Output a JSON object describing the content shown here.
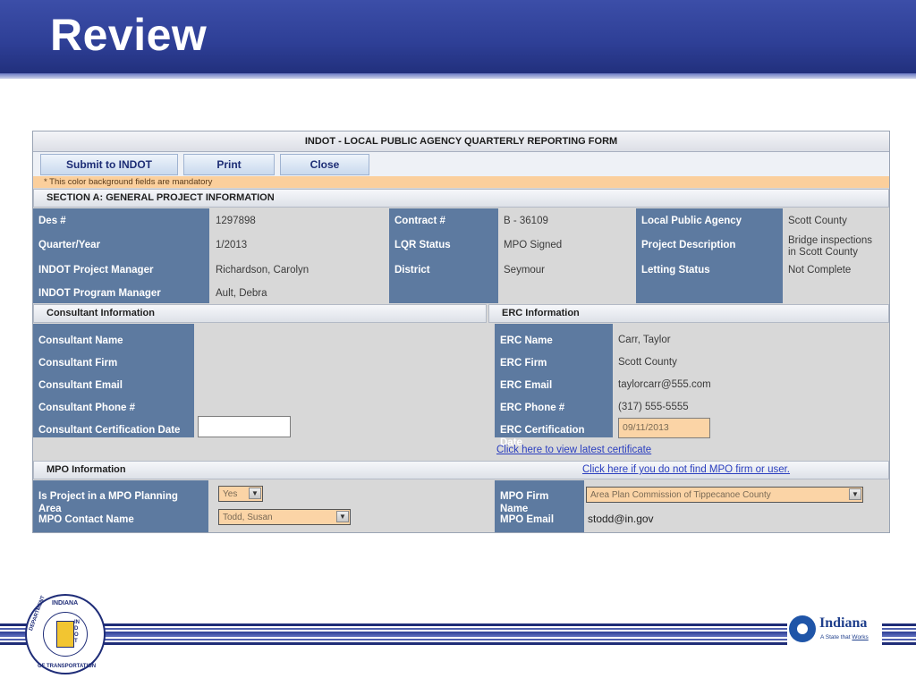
{
  "slide": {
    "title": "Review"
  },
  "form": {
    "title": "INDOT - LOCAL PUBLIC AGENCY QUARTERLY REPORTING FORM",
    "buttons": {
      "submit": "Submit to INDOT",
      "print": "Print",
      "close": "Close"
    },
    "mandatory_note": "* This color background fields are mandatory",
    "section_a": {
      "title": "SECTION A: GENERAL PROJECT INFORMATION",
      "des_label": "Des #",
      "des_value": "1297898",
      "quarter_label": "Quarter/Year",
      "quarter_value": "1/2013",
      "pm_label": "INDOT Project Manager",
      "pm_value": "Richardson, Carolyn",
      "prog_label": "INDOT Program Manager",
      "prog_value": "Ault, Debra",
      "contract_label": "Contract #",
      "contract_value": "B - 36109",
      "lqr_label": "LQR Status",
      "lqr_value": "MPO Signed",
      "district_label": "District",
      "district_value": "Seymour",
      "lpa_label": "Local Public Agency",
      "lpa_value": "Scott County",
      "desc_label": "Project Description",
      "desc_value": "Bridge inspections in Scott County",
      "letting_label": "Letting Status",
      "letting_value": "Not Complete"
    },
    "consultant": {
      "title": "Consultant Information",
      "name_label": "Consultant Name",
      "firm_label": "Consultant Firm",
      "email_label": "Consultant Email",
      "phone_label": "Consultant Phone #",
      "cert_label": "Consultant Certification Date",
      "cert_value": ""
    },
    "erc": {
      "title": "ERC Information",
      "name_label": "ERC Name",
      "name_value": "Carr, Taylor",
      "firm_label": "ERC Firm",
      "firm_value": "Scott County",
      "email_label": "ERC Email",
      "email_value": "taylorcarr@555.com",
      "phone_label": "ERC Phone #",
      "phone_value": "(317) 555-5555",
      "cert_label": "ERC Certification Date",
      "cert_value": "09/11/2013",
      "cert_link": "Click here to view latest certificate"
    },
    "mpo": {
      "title": "MPO Information",
      "not_found_link": "Click here if you do not find MPO firm or user.",
      "planning_label": "Is Project in a MPO Planning Area",
      "planning_value": "Yes",
      "contact_label": "MPO Contact Name",
      "contact_value": "Todd, Susan",
      "firm_label": "MPO Firm Name",
      "firm_value": "Area Plan Commission of Tippecanoe County",
      "email_label": "MPO Email",
      "email_value": "stodd@in.gov"
    }
  },
  "footer": {
    "seal": {
      "top": "INDIANA",
      "left": "DEPARTMENT",
      "bottom": "OF TRANSPORTATION",
      "mark": "INDOT"
    },
    "state_logo": {
      "name": "Indiana",
      "tagline_a": "A State that ",
      "tagline_b": "Works"
    }
  },
  "colors": {
    "header": "#2e3f96",
    "label_bg": "#5d7aa0",
    "mandatory": "#fbd4a6",
    "link": "#2b3fbf"
  }
}
